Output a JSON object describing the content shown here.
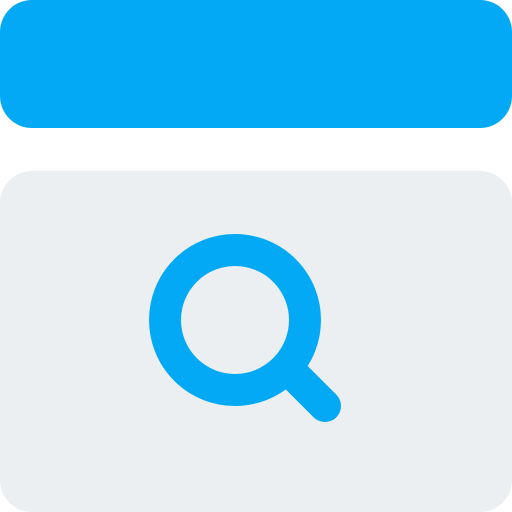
{
  "icon": {
    "name": "browser-search-icon",
    "parts": {
      "title_bar": "window-title-bar",
      "content": "window-content-panel",
      "symbol": "search-icon"
    }
  },
  "colors": {
    "accent": "#03a9f4",
    "panel": "#eceff1",
    "background": "#ffffff"
  }
}
